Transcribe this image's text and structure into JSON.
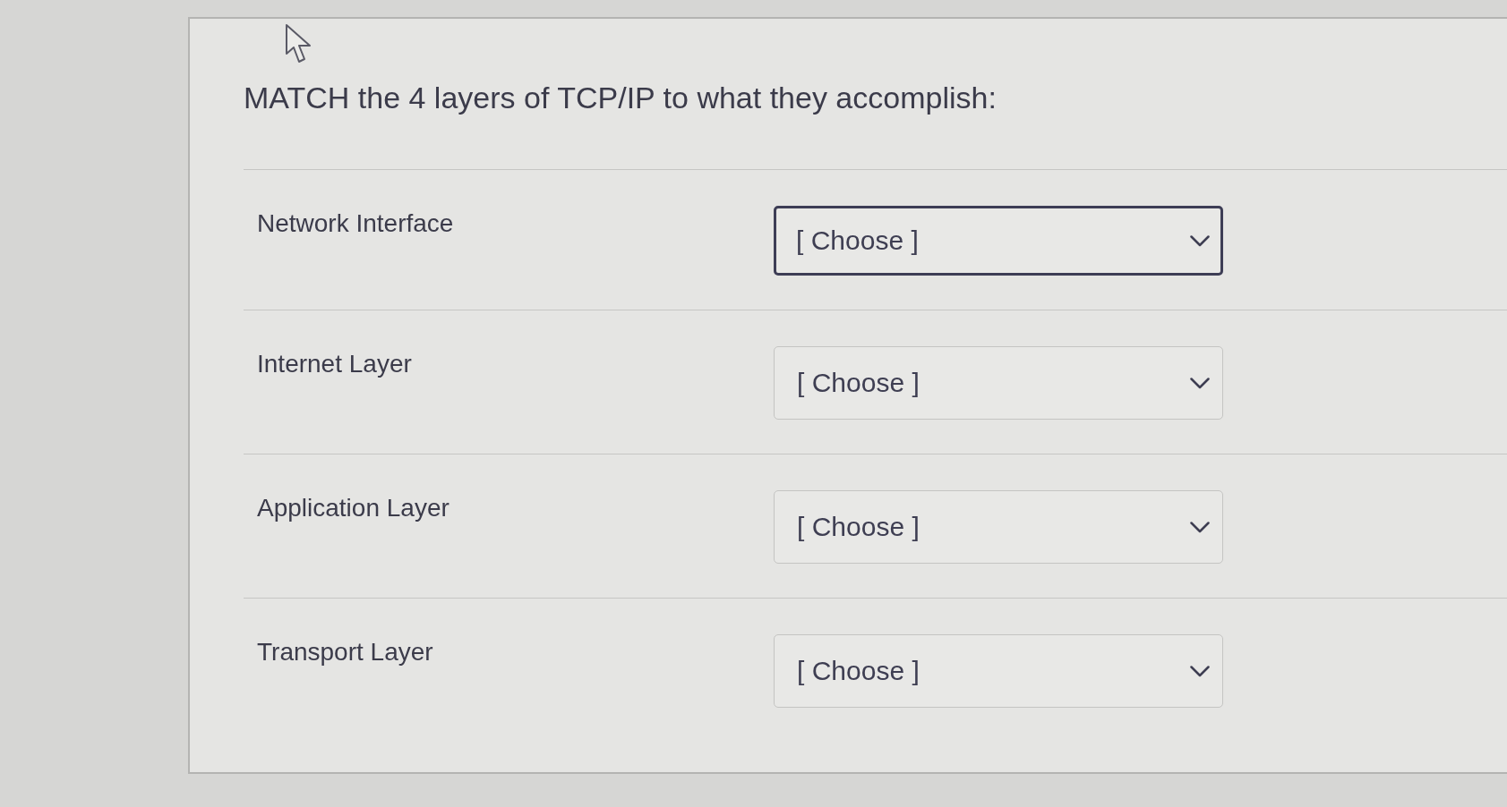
{
  "question": {
    "text": "MATCH the 4 layers of TCP/IP to what they accomplish:"
  },
  "rows": [
    {
      "label": "Network Interface",
      "select": {
        "value": "[ Choose ]",
        "focused": true
      }
    },
    {
      "label": "Internet Layer",
      "select": {
        "value": "[ Choose ]",
        "focused": false
      }
    },
    {
      "label": "Application Layer",
      "select": {
        "value": "[ Choose ]",
        "focused": false
      }
    },
    {
      "label": "Transport Layer",
      "select": {
        "value": "[ Choose ]",
        "focused": false
      }
    }
  ]
}
